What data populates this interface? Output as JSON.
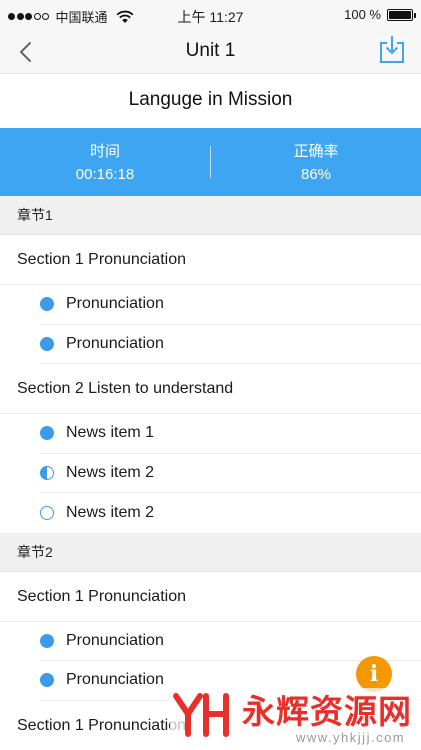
{
  "status_bar": {
    "carrier": "中国联通",
    "time": "上午 11:27",
    "battery": "100 %"
  },
  "nav": {
    "title": "Unit 1"
  },
  "lesson_title": "Languge in Mission",
  "stats": {
    "time_label": "时间",
    "time_value": "00:16:18",
    "accuracy_label": "正确率",
    "accuracy_value": "86%"
  },
  "chapters": [
    {
      "title": "章节1",
      "sections": [
        {
          "title": "Section 1 Pronunciation",
          "items": [
            {
              "label": "Pronunciation",
              "status": "complete"
            },
            {
              "label": "Pronunciation",
              "status": "complete"
            }
          ]
        },
        {
          "title": "Section 2 Listen to understand",
          "items": [
            {
              "label": "News item 1",
              "status": "complete"
            },
            {
              "label": "News item 2",
              "status": "partial"
            },
            {
              "label": "News item 2",
              "status": "not-started"
            }
          ]
        }
      ]
    },
    {
      "title": "章节2",
      "sections": [
        {
          "title": "Section 1 Pronunciation",
          "items": [
            {
              "label": "Pronunciation",
              "status": "complete"
            },
            {
              "label": "Pronunciation",
              "status": "complete"
            }
          ]
        },
        {
          "title": "Section 1 Pronunciation",
          "items": []
        }
      ]
    }
  ],
  "info_button": {
    "glyph": "i"
  },
  "watermark": {
    "text": "永辉资源网",
    "url": "www.yhkjjj.com"
  },
  "colors": {
    "accent": "#3ea5f3",
    "dot": "#3d9be9",
    "fab": "#f39800",
    "watermark": "#e8302a"
  }
}
